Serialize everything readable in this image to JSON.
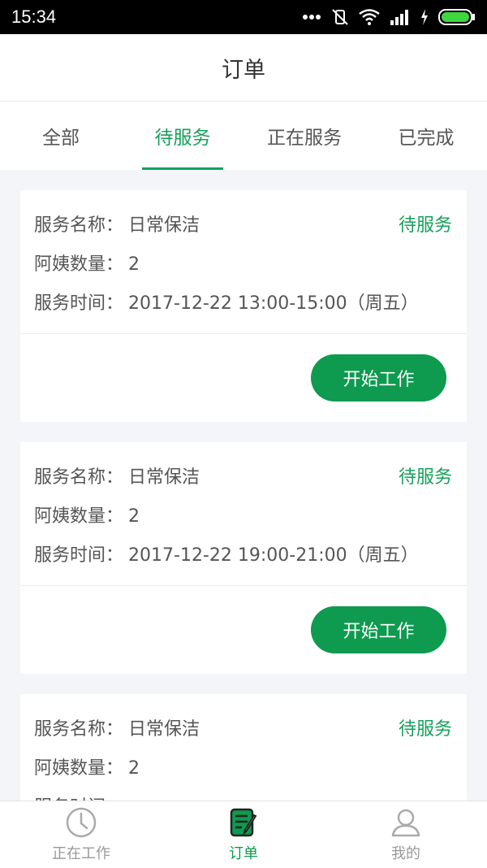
{
  "status_bar": {
    "time": "15:34"
  },
  "header": {
    "title": "订单"
  },
  "tabs": [
    {
      "label": "全部",
      "active": false
    },
    {
      "label": "待服务",
      "active": true
    },
    {
      "label": "正在服务",
      "active": false
    },
    {
      "label": "已完成",
      "active": false
    }
  ],
  "labels": {
    "service_name": "服务名称：",
    "aunt_count": "阿姨数量：",
    "service_time": "服务时间："
  },
  "orders": [
    {
      "service_name": "日常保洁",
      "aunt_count": "2",
      "service_time": "2017-12-22  13:00-15:00（周五）",
      "status": "待服务",
      "action": "开始工作"
    },
    {
      "service_name": "日常保洁",
      "aunt_count": "2",
      "service_time": "2017-12-22  19:00-21:00（周五）",
      "status": "待服务",
      "action": "开始工作"
    },
    {
      "service_name": "日常保洁",
      "aunt_count": "2",
      "service_time": "",
      "status": "待服务",
      "action": ""
    }
  ],
  "bottom_nav": [
    {
      "label": "正在工作",
      "icon": "clock-icon",
      "active": false
    },
    {
      "label": "订单",
      "icon": "order-list-icon",
      "active": true
    },
    {
      "label": "我的",
      "icon": "user-icon",
      "active": false
    }
  ],
  "colors": {
    "accent": "#16a05a",
    "button": "#0e9a4f",
    "background": "#f4f5f9"
  }
}
